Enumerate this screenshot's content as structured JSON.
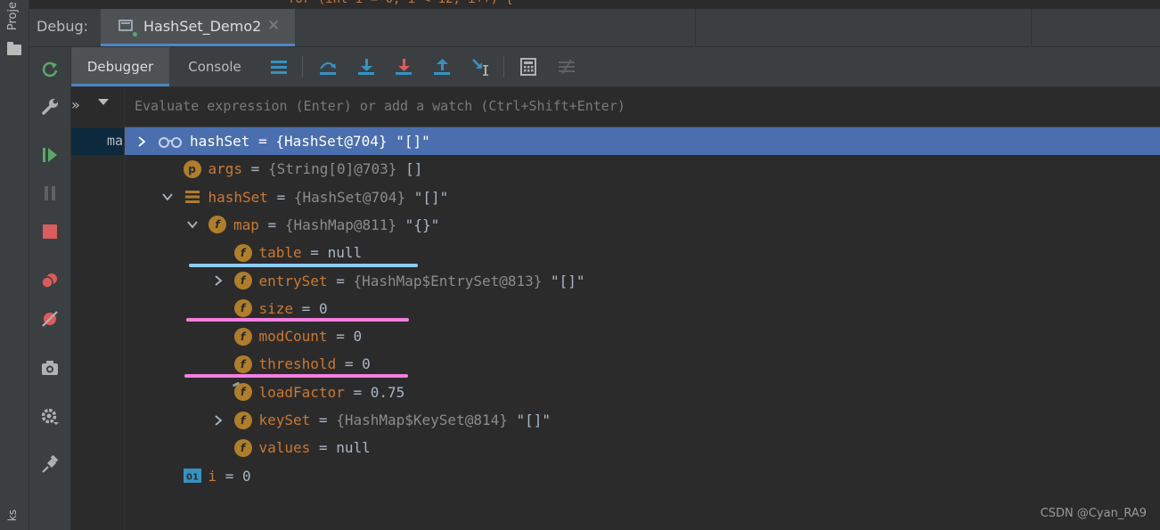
{
  "sidebar": {
    "project_label": "Proje",
    "bottom_label": "ks"
  },
  "debug_window": {
    "label": "Debug:",
    "session_tab": "HashSet_Demo2"
  },
  "sub_toolbar": {
    "tabs": [
      "Debugger",
      "Console"
    ],
    "icons": [
      "layout-icon",
      "step-over-icon",
      "step-into-icon",
      "force-step-into-icon",
      "step-out-icon",
      "run-to-cursor-icon",
      "evaluate-icon",
      "trace-icon"
    ]
  },
  "frames": {
    "more": "»",
    "item": "ma"
  },
  "evaluate": {
    "placeholder": "Evaluate expression (Enter) or add a watch (Ctrl+Shift+Enter)"
  },
  "variables": [
    {
      "icon": "watch",
      "name": "hashSet",
      "eq": " = ",
      "type": "{HashSet@704}",
      "val": " \"[]\"",
      "expander": "collapsed",
      "selected": true
    },
    {
      "icon": "p",
      "name": "args",
      "eq": " = ",
      "type": "{String[0]@703}",
      "val": " []",
      "expander": "none"
    },
    {
      "icon": "list",
      "name": "hashSet",
      "eq": " = ",
      "type": "{HashSet@704}",
      "val": " \"[]\"",
      "expander": "expanded"
    },
    {
      "icon": "f",
      "name": "map",
      "eq": " = ",
      "type": "{HashMap@811}",
      "val": " \"{}\"",
      "expander": "expanded"
    },
    {
      "icon": "f",
      "name": "table",
      "eq": " = ",
      "type": "",
      "val": "null",
      "expander": "none"
    },
    {
      "icon": "f",
      "name": "entrySet",
      "eq": " = ",
      "type": "{HashMap$EntrySet@813}",
      "val": " \"[]\"",
      "expander": "collapsed"
    },
    {
      "icon": "f",
      "name": "size",
      "eq": " = ",
      "type": "",
      "val": "0",
      "expander": "none"
    },
    {
      "icon": "f",
      "name": "modCount",
      "eq": " = ",
      "type": "",
      "val": "0",
      "expander": "none"
    },
    {
      "icon": "f",
      "name": "threshold",
      "eq": " = ",
      "type": "",
      "val": "0",
      "expander": "none"
    },
    {
      "icon": "f",
      "name": "loadFactor",
      "eq": " = ",
      "type": "",
      "val": "0.75",
      "expander": "none"
    },
    {
      "icon": "f",
      "name": "keySet",
      "eq": " = ",
      "type": "{HashMap$KeySet@814}",
      "val": " \"[]\"",
      "expander": "collapsed"
    },
    {
      "icon": "f",
      "name": "values",
      "eq": " = ",
      "type": "",
      "val": "null",
      "expander": "none"
    },
    {
      "icon": "i01",
      "name": "i",
      "eq": " = ",
      "type": "",
      "val": "0",
      "expander": "none"
    }
  ],
  "annotation_colors": {
    "blue": "#8ecdf3",
    "pink": "#f47fe0"
  },
  "watermark": "CSDN @Cyan_RA9"
}
